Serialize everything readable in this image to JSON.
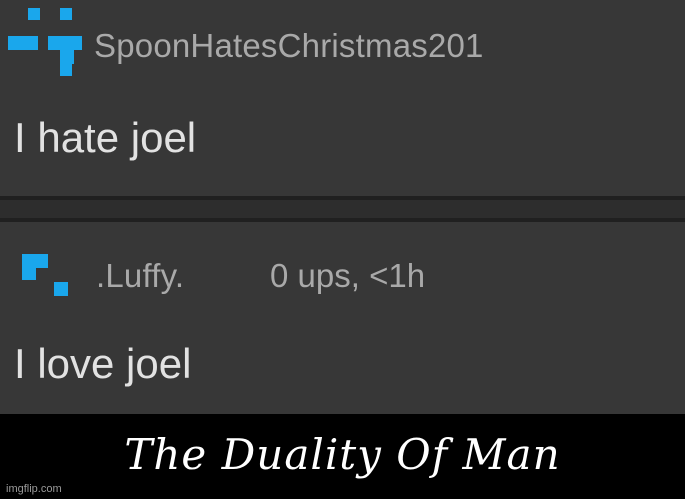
{
  "comments": [
    {
      "username": "SpoonHatesChristmas201",
      "text": "I hate joel",
      "avatar_icon": "pixel-avatar-icon"
    },
    {
      "username": ".Luffy.",
      "meta": "0 ups, <1h",
      "text": "I love joel",
      "avatar_icon": "pixel-avatar-icon"
    }
  ],
  "caption": "The Duality Of Man",
  "watermark": "imgflip.com",
  "colors": {
    "panel": "#373737",
    "avatar": "#1aa7ec",
    "username": "#a9a9a9",
    "text": "#e2e2e2",
    "caption_bg": "#000000",
    "caption_text": "#ffffff"
  }
}
